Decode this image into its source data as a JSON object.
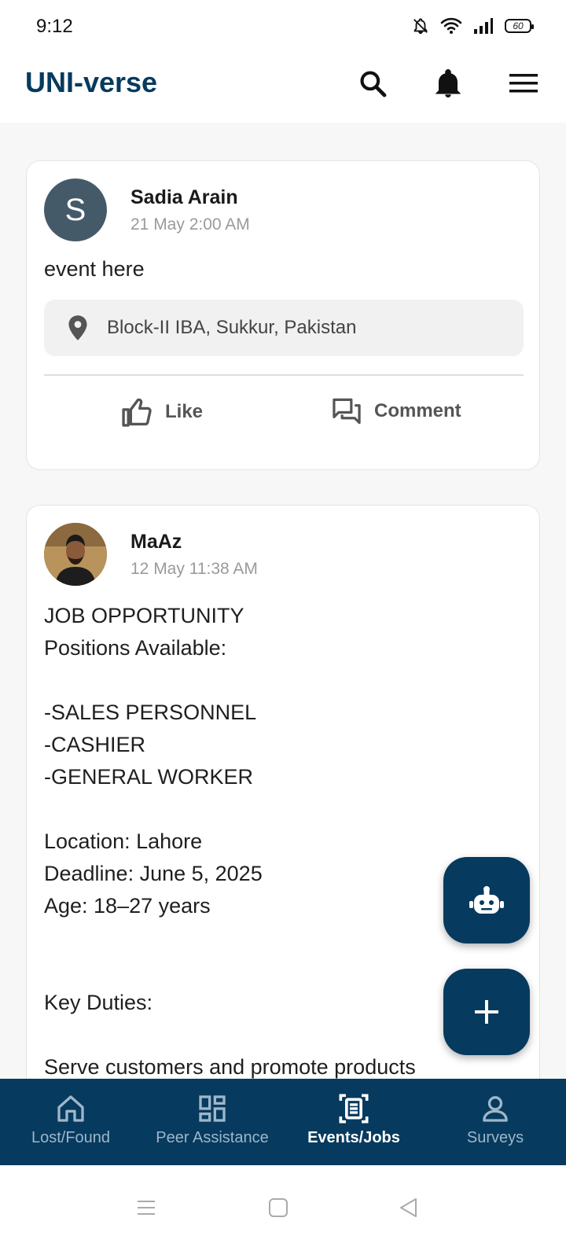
{
  "status": {
    "time": "9:12",
    "battery": "60"
  },
  "app": {
    "title": "UNI-verse"
  },
  "posts": [
    {
      "author": "Sadia Arain",
      "avatar_letter": "S",
      "timestamp": "21 May 2:00 AM",
      "text": "event here",
      "location": "Block-II IBA, Sukkur, Pakistan",
      "like_label": "Like",
      "comment_label": "Comment"
    },
    {
      "author": "MaAz",
      "timestamp": "12 May 11:38 AM",
      "text": "JOB OPPORTUNITY\nPositions Available:\n\n-SALES PERSONNEL\n-CASHIER\n-GENERAL WORKER\n\nLocation: Lahore\nDeadline: June 5, 2025\nAge: 18–27 years\n\n\nKey Duties:\n\nServe customers and promote products"
    }
  ],
  "nav": {
    "items": [
      {
        "label": "Lost/Found",
        "icon": "home-icon"
      },
      {
        "label": "Peer Assistance",
        "icon": "dashboard-icon"
      },
      {
        "label": "Events/Jobs",
        "icon": "events-icon",
        "active": true
      },
      {
        "label": "Surveys",
        "icon": "person-icon"
      }
    ]
  },
  "colors": {
    "primary": "#063a5e",
    "avatar": "#455a69"
  }
}
